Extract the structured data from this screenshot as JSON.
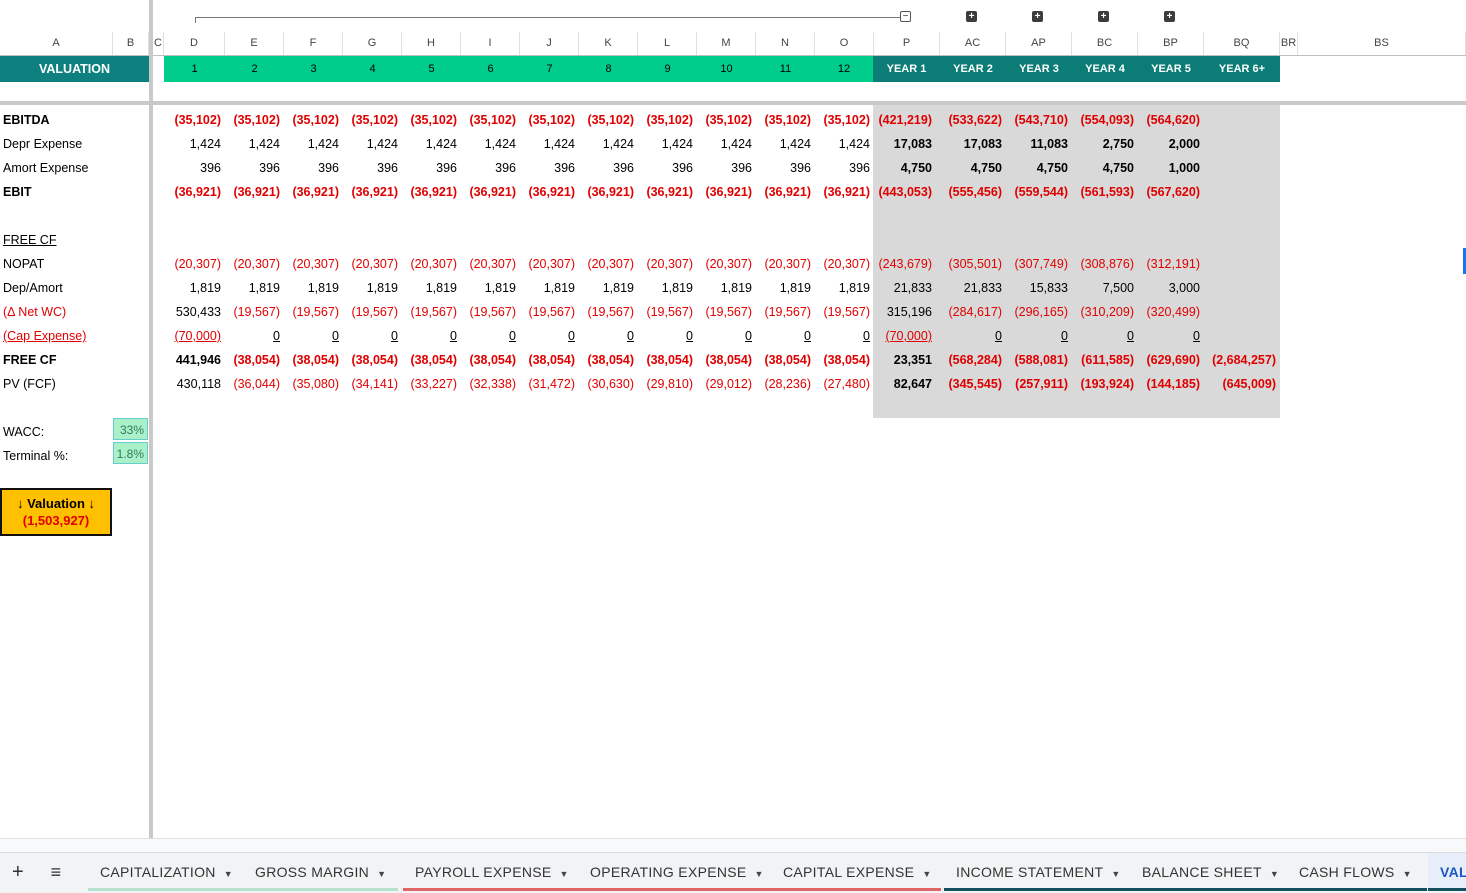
{
  "columns": [
    "A",
    "B",
    "C",
    "D",
    "E",
    "F",
    "G",
    "H",
    "I",
    "J",
    "K",
    "L",
    "M",
    "N",
    "O",
    "P",
    "AC",
    "AP",
    "BC",
    "BP",
    "BQ",
    "BR",
    "BS"
  ],
  "header_row": {
    "title": "VALUATION",
    "months": [
      "1",
      "2",
      "3",
      "4",
      "5",
      "6",
      "7",
      "8",
      "9",
      "10",
      "11",
      "12"
    ],
    "years": [
      "YEAR 1",
      "YEAR 2",
      "YEAR 3",
      "YEAR 4",
      "YEAR 5",
      "YEAR 6+"
    ]
  },
  "group_buttons": [
    "−",
    "+",
    "+",
    "+",
    "+"
  ],
  "rows": [
    {
      "label": "EBITDA",
      "bold": true,
      "values": [
        "(35,102)",
        "(35,102)",
        "(35,102)",
        "(35,102)",
        "(35,102)",
        "(35,102)",
        "(35,102)",
        "(35,102)",
        "(35,102)",
        "(35,102)",
        "(35,102)",
        "(35,102)",
        "(421,219)",
        "(533,622)",
        "(543,710)",
        "(554,093)",
        "(564,620)",
        ""
      ]
    },
    {
      "label": "Depr Expense",
      "values": [
        "1,424",
        "1,424",
        "1,424",
        "1,424",
        "1,424",
        "1,424",
        "1,424",
        "1,424",
        "1,424",
        "1,424",
        "1,424",
        "1,424",
        "17,083",
        "17,083",
        "11,083",
        "2,750",
        "2,000",
        ""
      ]
    },
    {
      "label": "Amort Expense",
      "values": [
        "396",
        "396",
        "396",
        "396",
        "396",
        "396",
        "396",
        "396",
        "396",
        "396",
        "396",
        "396",
        "4,750",
        "4,750",
        "4,750",
        "4,750",
        "1,000",
        ""
      ]
    },
    {
      "label": "EBIT",
      "bold": true,
      "values": [
        "(36,921)",
        "(36,921)",
        "(36,921)",
        "(36,921)",
        "(36,921)",
        "(36,921)",
        "(36,921)",
        "(36,921)",
        "(36,921)",
        "(36,921)",
        "(36,921)",
        "(36,921)",
        "(443,053)",
        "(555,456)",
        "(559,544)",
        "(561,593)",
        "(567,620)",
        ""
      ]
    },
    {
      "label": "",
      "values": []
    },
    {
      "label": "FREE CF",
      "underline": true,
      "values": []
    },
    {
      "label": "NOPAT",
      "values": [
        "(20,307)",
        "(20,307)",
        "(20,307)",
        "(20,307)",
        "(20,307)",
        "(20,307)",
        "(20,307)",
        "(20,307)",
        "(20,307)",
        "(20,307)",
        "(20,307)",
        "(20,307)",
        "(243,679)",
        "(305,501)",
        "(307,749)",
        "(308,876)",
        "(312,191)",
        ""
      ]
    },
    {
      "label": "Dep/Amort",
      "values": [
        "1,819",
        "1,819",
        "1,819",
        "1,819",
        "1,819",
        "1,819",
        "1,819",
        "1,819",
        "1,819",
        "1,819",
        "1,819",
        "1,819",
        "21,833",
        "21,833",
        "15,833",
        "7,500",
        "3,000",
        ""
      ]
    },
    {
      "label": "(Δ Net WC)",
      "red_label": true,
      "values": [
        "530,433",
        "(19,567)",
        "(19,567)",
        "(19,567)",
        "(19,567)",
        "(19,567)",
        "(19,567)",
        "(19,567)",
        "(19,567)",
        "(19,567)",
        "(19,567)",
        "(19,567)",
        "315,196",
        "(284,617)",
        "(296,165)",
        "(310,209)",
        "(320,499)",
        ""
      ]
    },
    {
      "label": "(Cap Expense)",
      "red_label": true,
      "underline": true,
      "values": [
        "(70,000)",
        "0",
        "0",
        "0",
        "0",
        "0",
        "0",
        "0",
        "0",
        "0",
        "0",
        "0",
        "(70,000)",
        "0",
        "0",
        "0",
        "0",
        ""
      ]
    },
    {
      "label": "FREE CF",
      "bold": true,
      "values": [
        "441,946",
        "(38,054)",
        "(38,054)",
        "(38,054)",
        "(38,054)",
        "(38,054)",
        "(38,054)",
        "(38,054)",
        "(38,054)",
        "(38,054)",
        "(38,054)",
        "(38,054)",
        "23,351",
        "(568,284)",
        "(588,081)",
        "(611,585)",
        "(629,690)",
        "(2,684,257)"
      ]
    },
    {
      "label": "PV (FCF)",
      "values": [
        "430,118",
        "(36,044)",
        "(35,080)",
        "(34,141)",
        "(33,227)",
        "(32,338)",
        "(31,472)",
        "(30,630)",
        "(29,810)",
        "(29,012)",
        "(28,236)",
        "(27,480)",
        "82,647",
        "(345,545)",
        "(257,911)",
        "(193,924)",
        "(144,185)",
        "(645,009)"
      ]
    }
  ],
  "inputs": {
    "wacc_label": "WACC:",
    "wacc_value": "33%",
    "terminal_label": "Terminal %:",
    "terminal_value": "1.8%"
  },
  "valuation_box": {
    "title": "↓ Valuation ↓",
    "value": "(1,503,927)"
  },
  "tabs": [
    {
      "label": "CAPITALIZATION",
      "color": "#b7e1cd"
    },
    {
      "label": "GROSS MARGIN",
      "color": "#b7e1cd"
    },
    {
      "label": "PAYROLL EXPENSE",
      "color": "#e06666"
    },
    {
      "label": "OPERATING EXPENSE",
      "color": "#e06666"
    },
    {
      "label": "CAPITAL EXPENSE",
      "color": "#e06666"
    },
    {
      "label": "INCOME STATEMENT",
      "color": "#134f5c"
    },
    {
      "label": "BALANCE SHEET",
      "color": "#134f5c"
    },
    {
      "label": "CASH FLOWS",
      "color": "#134f5c"
    },
    {
      "label": "VAL",
      "color": "#134f5c",
      "active": true
    }
  ],
  "colors": {
    "teal": "#0e8080",
    "green": "#00cc8c",
    "dark_teal": "#0b7d76",
    "negative": "#e00000",
    "grey_block": "#d9d9d9",
    "valuation_fill": "#ffc000"
  }
}
